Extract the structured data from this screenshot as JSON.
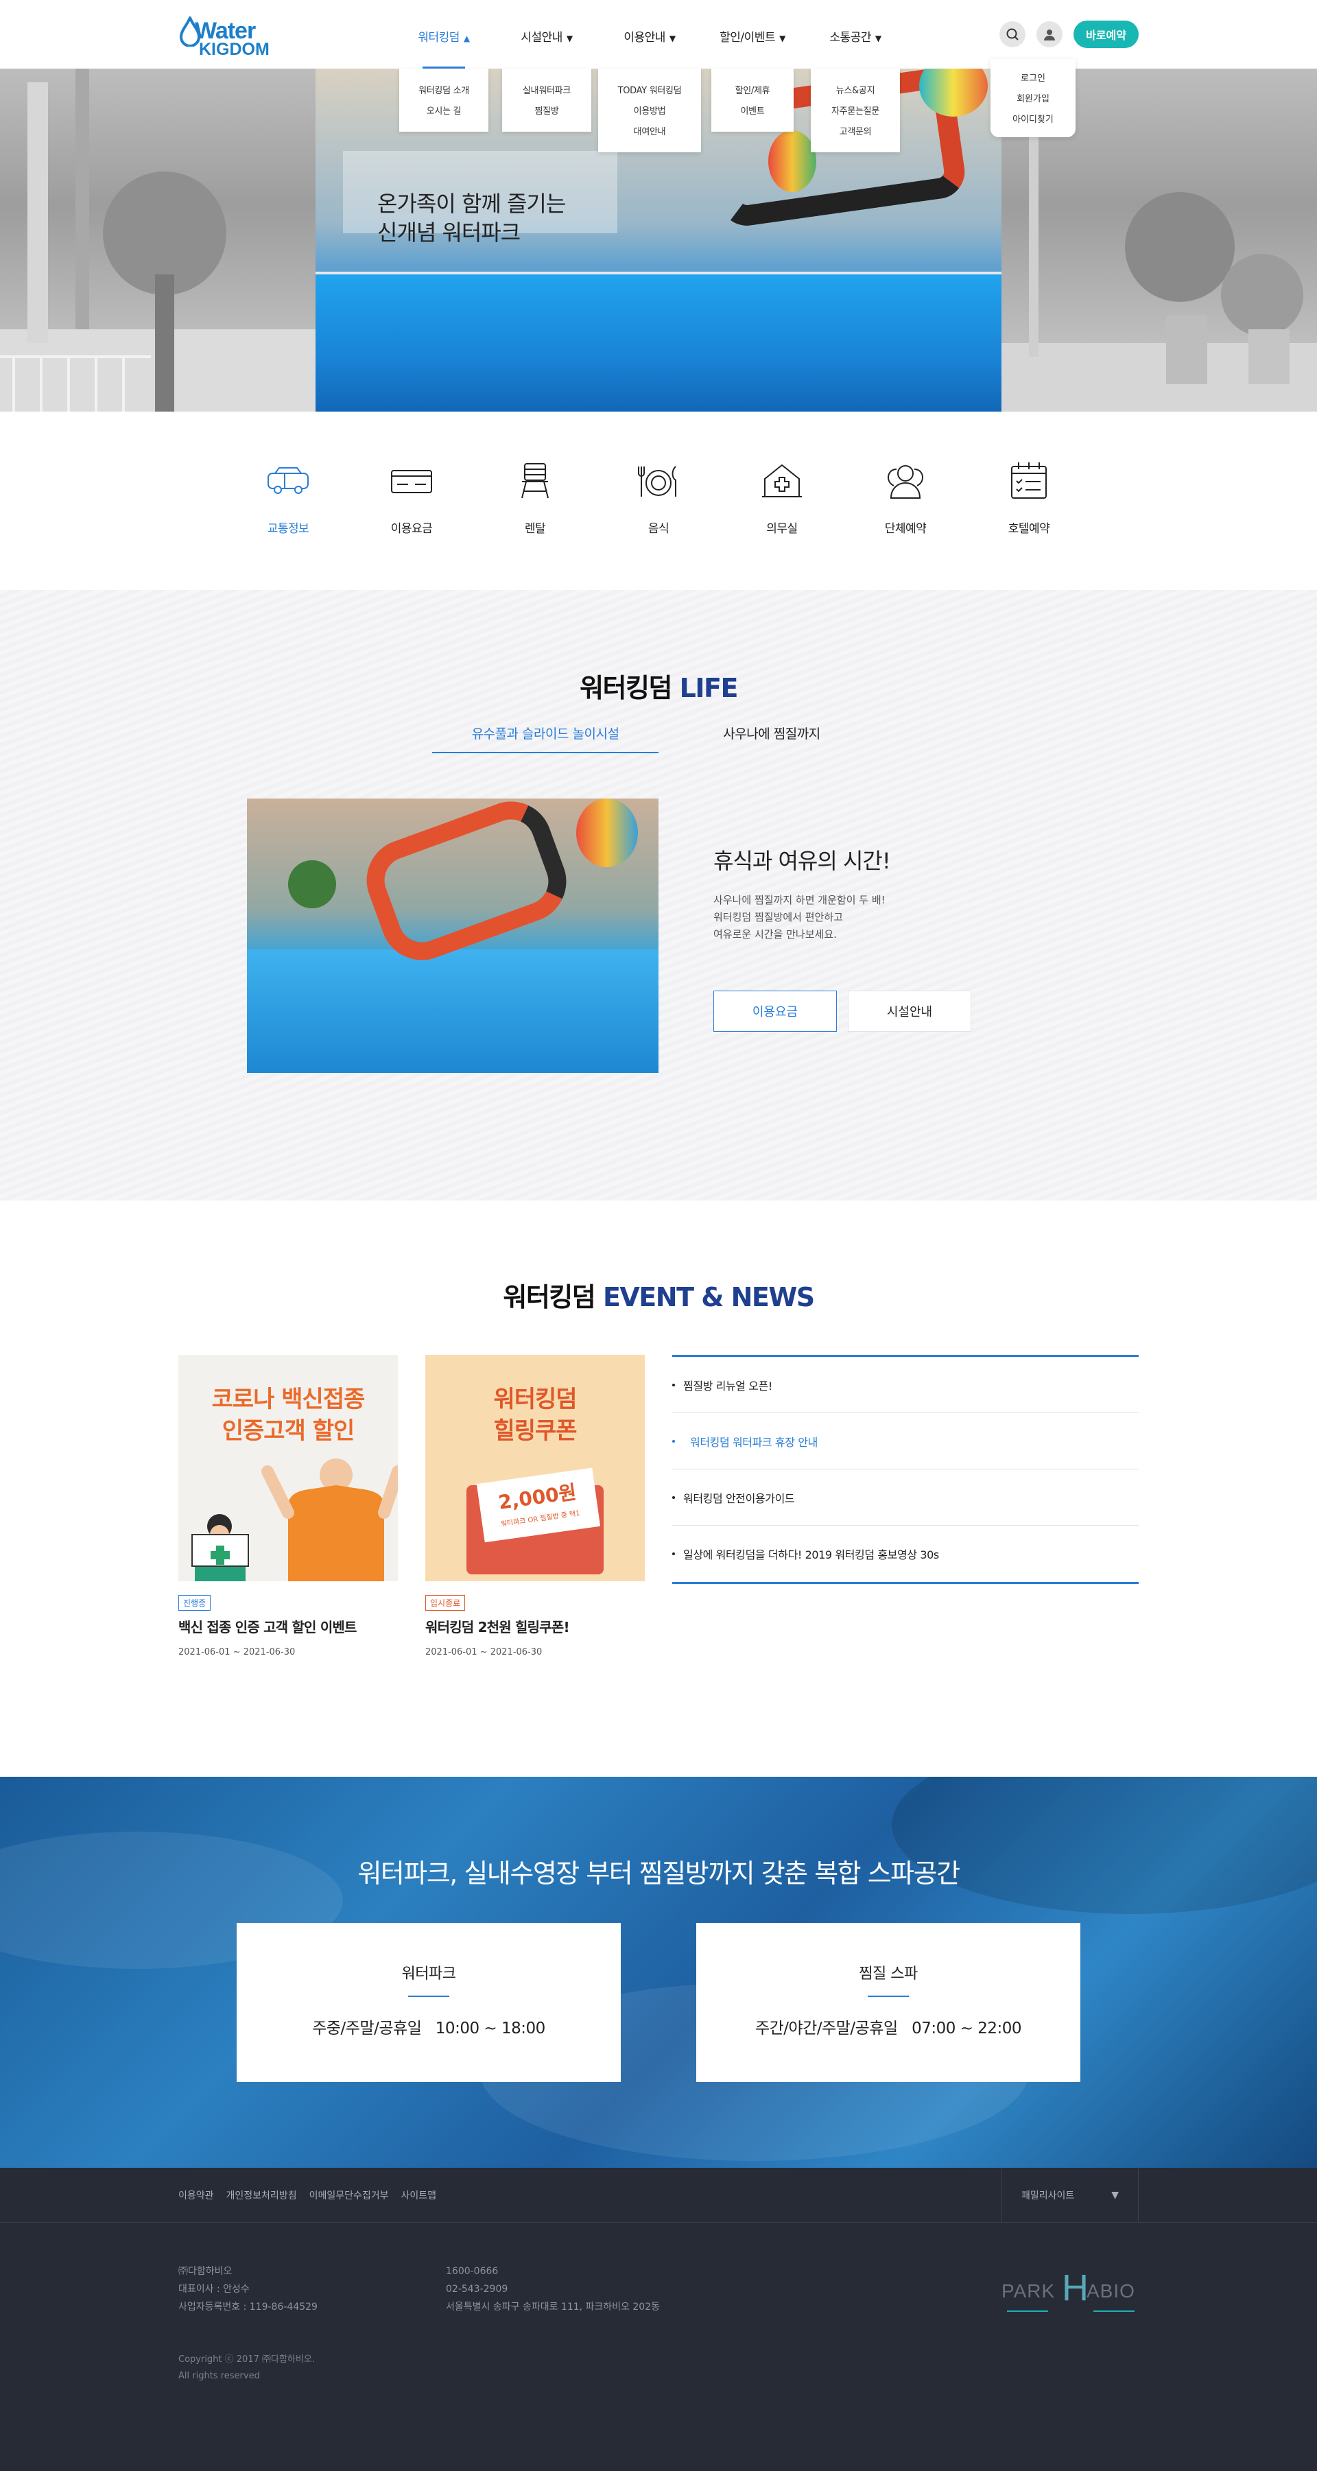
{
  "logo": {
    "line1": "Water",
    "line2": "KIGDOM"
  },
  "nav": {
    "menus": [
      {
        "label": "워터킹덤",
        "sub": [
          "워터킹덤 소개",
          "오시는 길"
        ]
      },
      {
        "label": "시설안내",
        "sub": [
          "실내워터파크",
          "찜질방"
        ]
      },
      {
        "label": "이용안내",
        "sub": [
          "TODAY 워터킹덤",
          "이용방법",
          "대여안내"
        ]
      },
      {
        "label": "할인/이벤트",
        "sub": [
          "할인/제휴",
          "이벤트"
        ]
      },
      {
        "label": "소통공간",
        "sub": [
          "뉴스&공지",
          "자주묻는질문",
          "고객문의"
        ]
      }
    ],
    "book_label": "바로예약",
    "login_menu": [
      "로그인",
      "회원가입",
      "아이디찾기"
    ]
  },
  "hero": {
    "line1": "온가족이 함께 즐기는",
    "line2": "신개념 워터파크"
  },
  "quick": [
    {
      "label": "교통정보",
      "icon": "bus-icon"
    },
    {
      "label": "이용요금",
      "icon": "ticket-icon"
    },
    {
      "label": "렌탈",
      "icon": "chair-icon"
    },
    {
      "label": "음식",
      "icon": "dish-icon"
    },
    {
      "label": "의무실",
      "icon": "medical-icon"
    },
    {
      "label": "단체예약",
      "icon": "group-icon"
    },
    {
      "label": "호텔예약",
      "icon": "calendar-icon"
    }
  ],
  "life": {
    "title_main": "워터킹덤 ",
    "title_hl": "LIFE",
    "tabs": [
      "유수풀과 슬라이드 놀이시설",
      "사우나에 찜질까지"
    ],
    "heading": "휴식과 여유의 시간!",
    "desc": [
      "사우나에 찜질까지 하면 개운함이 두 배!",
      "워터킹덤 찜질방에서 편안하고",
      "여유로운 시간을 만나보세요."
    ],
    "btn_primary": "이용요금",
    "btn_secondary": "시설안내"
  },
  "event": {
    "title_main": "워터킹덤 ",
    "title_hl": "EVENT & NEWS",
    "cards": [
      {
        "thumb_line1": "코로나 백신접종",
        "thumb_line2": "인증고객 할인",
        "badge": "진행중",
        "title": "백신 접종 인증 고객 할인 이벤트",
        "date": "2021-06-01 ~ 2021-06-30"
      },
      {
        "thumb_line1": "워터킹덤",
        "thumb_line2": "힐링쿠폰",
        "coupon": "2,000원",
        "coupon_sub": "워터파크 OR 찜질방 중 택1",
        "badge": "임시종료",
        "title": "워터킹덤 2천원 힐링쿠폰!",
        "date": "2021-06-01 ~ 2021-06-30"
      }
    ],
    "news": [
      "찜질방 리뉴얼 오픈!",
      "워터킹덤 워터파크 휴장 안내",
      "워터킹덤 안전이용가이드",
      "일상에 워터킹덤을 더하다! 2019 워터킹덤 홍보영상 30s"
    ]
  },
  "hours": {
    "title": "워터파크, 실내수영장 부터 찜질방까지 갖춘 복합 스파공간",
    "boxes": [
      {
        "name": "워터파크",
        "days": "주중/주말/공휴일",
        "time": "10:00 ~ 18:00"
      },
      {
        "name": "찜질 스파",
        "days": "주간/야간/주말/공휴일",
        "time": "07:00 ~ 22:00"
      }
    ]
  },
  "footer": {
    "links": [
      "이용약관",
      "개인정보처리방침",
      "이메일무단수집거부",
      "사이트맵"
    ],
    "family_label": "패밀리사이트",
    "company": [
      "㈜다함하비오",
      "대표이사 : 안성수",
      "사업자등록번호 : 119-86-44529"
    ],
    "contact": [
      "1600-0666",
      "02-543-2909",
      "서울특별시 송파구 송파대로 111, 파크하비오 202동"
    ],
    "copyright": [
      "Copyright ⓒ 2017 ㈜다함하비오.",
      "All rights reserved"
    ],
    "logo": {
      "p": "PARK",
      "h": "H",
      "a": "ABIO"
    }
  },
  "colors": {
    "accent": "#2a7dd8",
    "brand_teal": "#19b7b3",
    "title_navy": "#1f3f8f",
    "footer_bg": "#262b36"
  }
}
